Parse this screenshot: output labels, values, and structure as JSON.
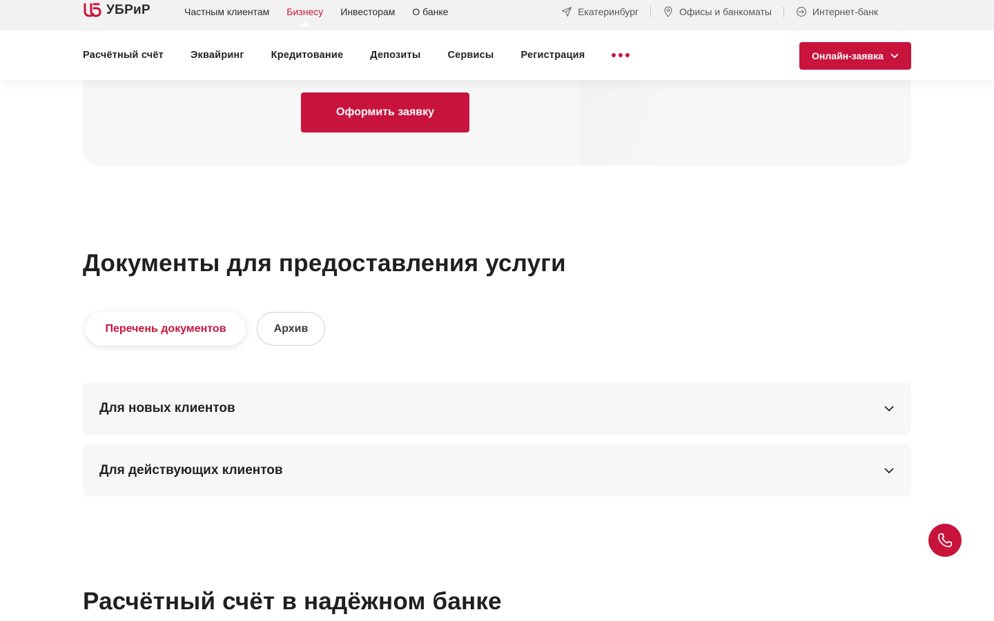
{
  "header": {
    "logo_text": "УБРиР",
    "top_nav": [
      {
        "label": "Частным клиентам"
      },
      {
        "label": "Бизнесу"
      },
      {
        "label": "Инвесторам"
      },
      {
        "label": "О банке"
      }
    ],
    "city": "Екатеринбург",
    "offices": "Офисы и банкоматы",
    "internet_bank": "Интернет-банк"
  },
  "main_nav": {
    "items": [
      {
        "label": "Расчётный счёт"
      },
      {
        "label": "Эквайринг"
      },
      {
        "label": "Кредитование"
      },
      {
        "label": "Депозиты"
      },
      {
        "label": "Сервисы"
      },
      {
        "label": "Регистрация"
      }
    ],
    "online_button": "Онлайн-заявка"
  },
  "hero": {
    "cta_label": "Оформить заявку"
  },
  "documents": {
    "title": "Документы для предоставления услуги",
    "tabs": [
      {
        "label": "Перечень документов",
        "active": true
      },
      {
        "label": "Архив",
        "active": false
      }
    ],
    "accordion": [
      {
        "label": "Для новых клиентов"
      },
      {
        "label": "Для действующих клиентов"
      }
    ]
  },
  "next_section": {
    "title": "Расчётный счёт в надёжном банке"
  },
  "colors": {
    "accent": "#c8143c",
    "topbar_bg": "#f2f2f2",
    "card_bg": "#f7f7f7"
  }
}
